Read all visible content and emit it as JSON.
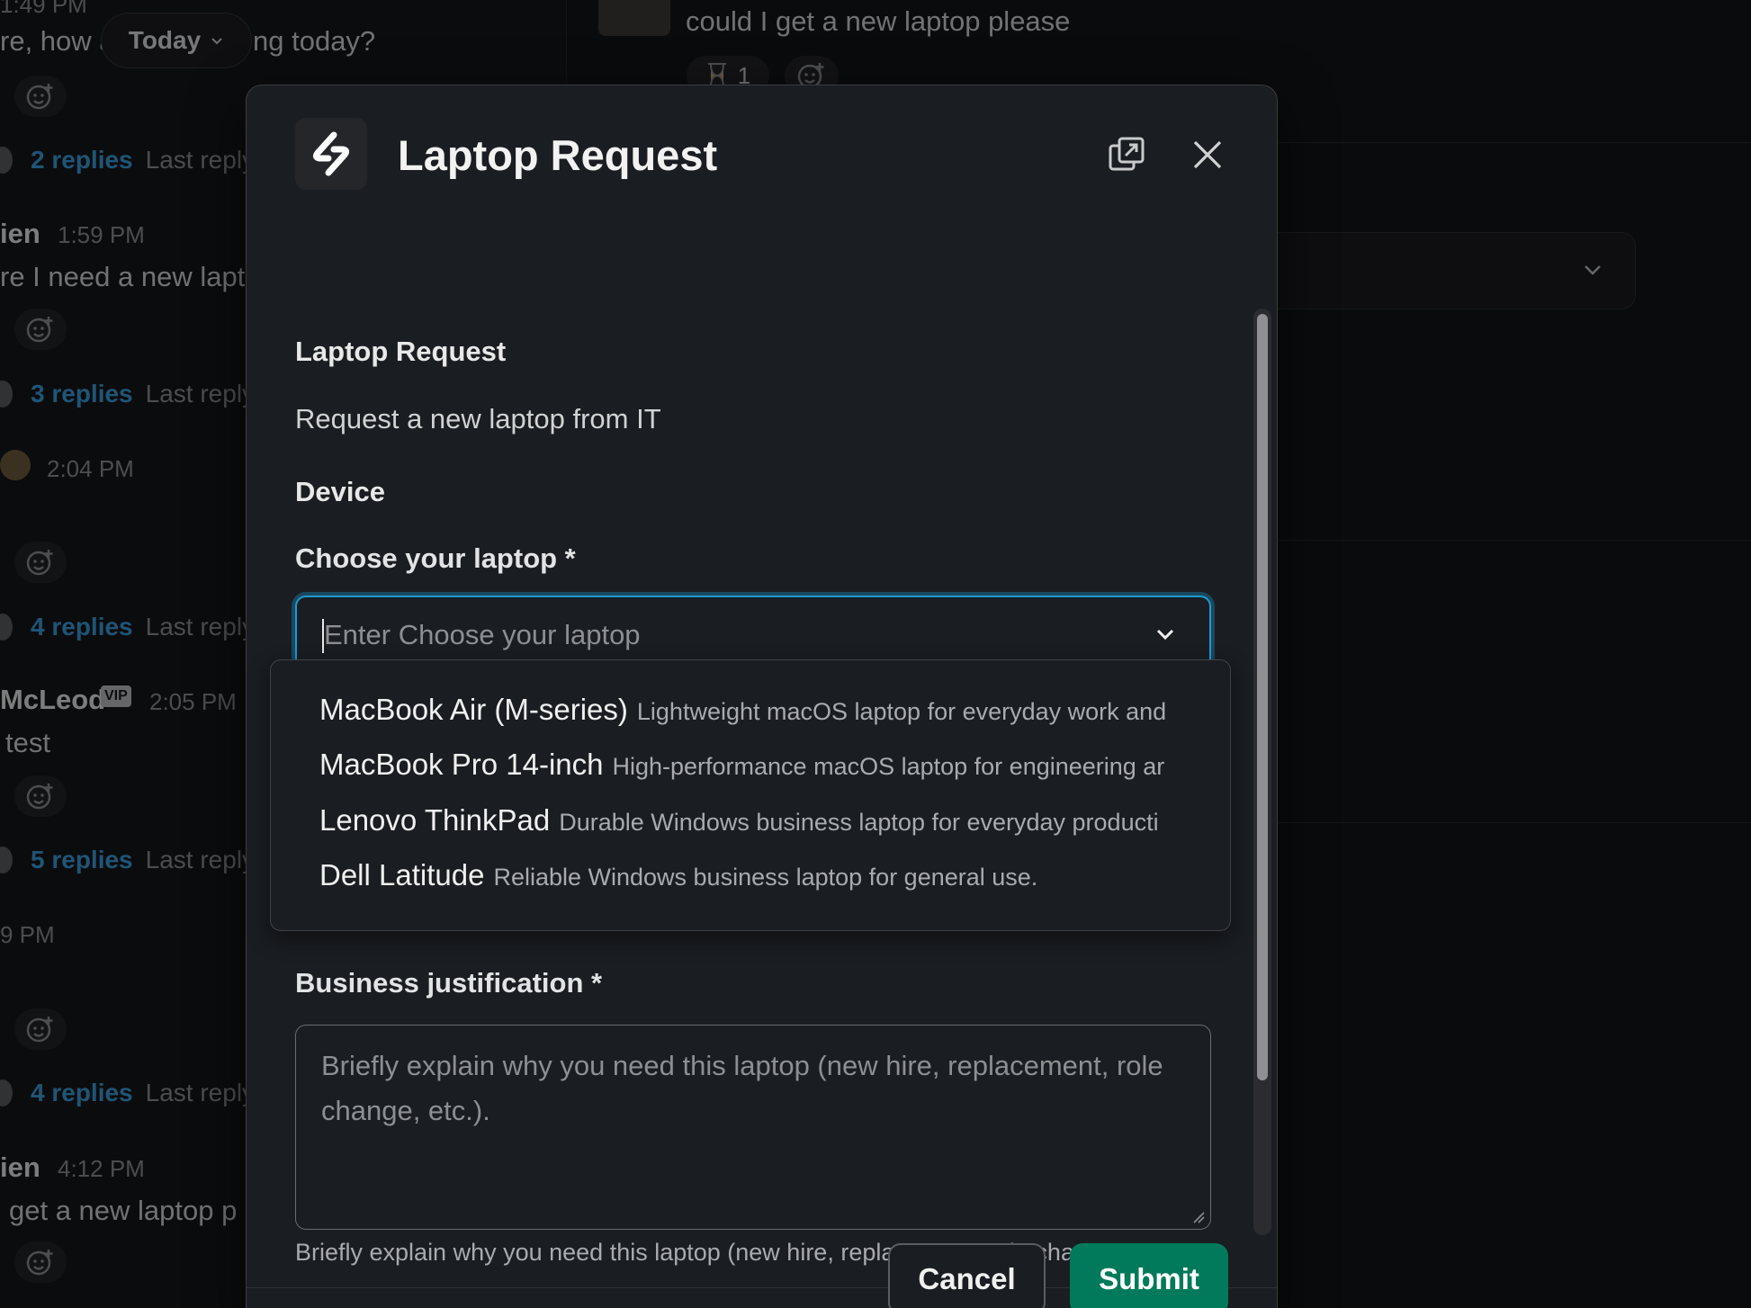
{
  "background": {
    "left_messages": [
      {
        "time": "1:49 PM",
        "text": "re, how a"
      },
      {
        "text_after": "ng today?"
      }
    ],
    "today_pill": {
      "label": "Today"
    },
    "threads": [
      {
        "replies": "2 replies",
        "last": "Last reply"
      },
      {
        "replies": "3 replies",
        "last": "Last reply"
      },
      {
        "replies": "4 replies",
        "last": "Last reply"
      },
      {
        "replies": "5 replies",
        "last": "Last reply"
      },
      {
        "replies": "4 replies",
        "last": "Last reply"
      }
    ],
    "names": {
      "n1": "ien",
      "n2": "McLeod",
      "n3": "ien"
    },
    "times": {
      "t1": "1:59 PM",
      "t2": "2:04 PM",
      "t3": "2:05 PM",
      "t4": "9 PM",
      "t5": "4:12 PM"
    },
    "texts": {
      "m1": "re I need a new lapt",
      "m2": "test",
      "m3": "get a new laptop p"
    },
    "vip": "VIP",
    "right": {
      "message": "could I get a new laptop please",
      "reaction_count": "1"
    }
  },
  "modal": {
    "title": "Laptop Request",
    "section_title": "Laptop Request",
    "description": "Request a new laptop from IT",
    "device_heading": "Device",
    "laptop_field": {
      "label": "Choose your laptop *",
      "placeholder": "Enter Choose your laptop"
    },
    "options": [
      {
        "name": "MacBook Air (M-series)",
        "desc": "Lightweight macOS laptop for everyday work and"
      },
      {
        "name": "MacBook Pro 14-inch",
        "desc": "High-performance macOS laptop for engineering ar"
      },
      {
        "name": "Lenovo ThinkPad",
        "desc": "Durable Windows business laptop for everyday producti"
      },
      {
        "name": "Dell Latitude",
        "desc": "Reliable Windows business laptop for general use."
      }
    ],
    "justification": {
      "label": "Business justification *",
      "placeholder": "Briefly explain why you need this laptop (new hire, replacement, role change, etc.).",
      "help": "Briefly explain why you need this laptop (new hire, replacement, role change,"
    },
    "buttons": {
      "cancel": "Cancel",
      "submit": "Submit"
    }
  },
  "colors": {
    "accent_focus": "#1d9bd1",
    "submit_green": "#007a5a",
    "link_blue": "#3a9bd9"
  }
}
